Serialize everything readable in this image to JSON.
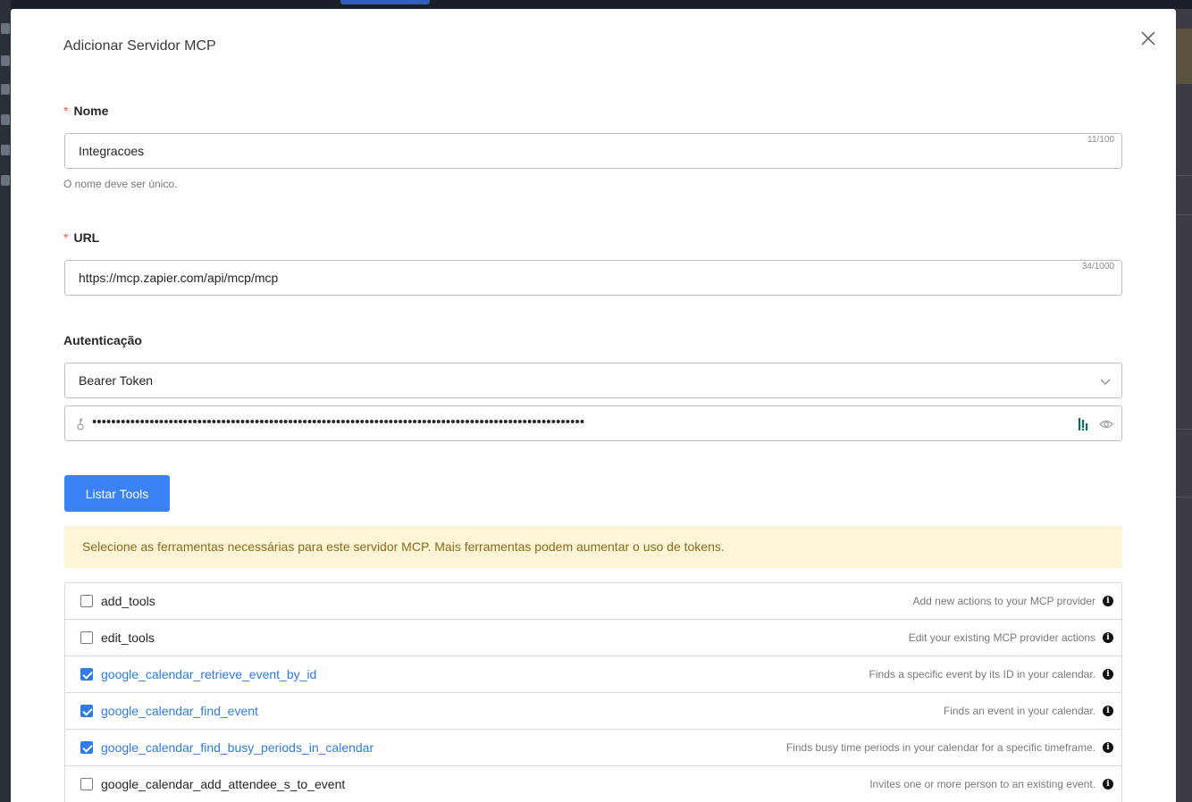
{
  "modal": {
    "title": "Adicionar Servidor MCP"
  },
  "form": {
    "name": {
      "required_mark": "*",
      "label": "Nome",
      "value": "Integracoes",
      "counter": "11/100",
      "help": "O nome deve ser único."
    },
    "url": {
      "required_mark": "*",
      "label": "URL",
      "value": "https://mcp.zapier.com/api/mcp/mcp",
      "counter": "34/1000"
    },
    "auth": {
      "label": "Autenticação",
      "selected": "Bearer Token",
      "token_masked": "•••••••••••••••••••••••••••••••••••••••••••••••••••••••••••••••••••••••••••••••••••••••••••••••••••••••"
    },
    "list_button_label": "Listar Tools"
  },
  "alert": {
    "text": "Selecione as ferramentas necessárias para este servidor MCP. Mais ferramentas podem aumentar o uso de tokens."
  },
  "tools": [
    {
      "name": "add_tools",
      "description": "Add new actions to your MCP provider",
      "checked": false
    },
    {
      "name": "edit_tools",
      "description": "Edit your existing MCP provider actions",
      "checked": false
    },
    {
      "name": "google_calendar_retrieve_event_by_id",
      "description": "Finds a specific event by its ID in your calendar.",
      "checked": true
    },
    {
      "name": "google_calendar_find_event",
      "description": "Finds an event in your calendar.",
      "checked": true
    },
    {
      "name": "google_calendar_find_busy_periods_in_calendar",
      "description": "Finds busy time periods in your calendar for a specific timeframe.",
      "checked": true
    },
    {
      "name": "google_calendar_add_attendee_s_to_event",
      "description": "Invites one or more person to an existing event.",
      "checked": false
    }
  ],
  "icons": {
    "close": "close-icon",
    "chevron": "chevron-down-icon",
    "key": "key-icon",
    "password_manager": "password-manager-icon",
    "eye": "eye-icon",
    "info": "info-icon"
  },
  "colors": {
    "primary": "#3b82f6",
    "checked": "#2f7be6",
    "alert_bg": "#fdf5d6",
    "alert_text": "#8a6a1d",
    "required": "#ff4d4f"
  }
}
